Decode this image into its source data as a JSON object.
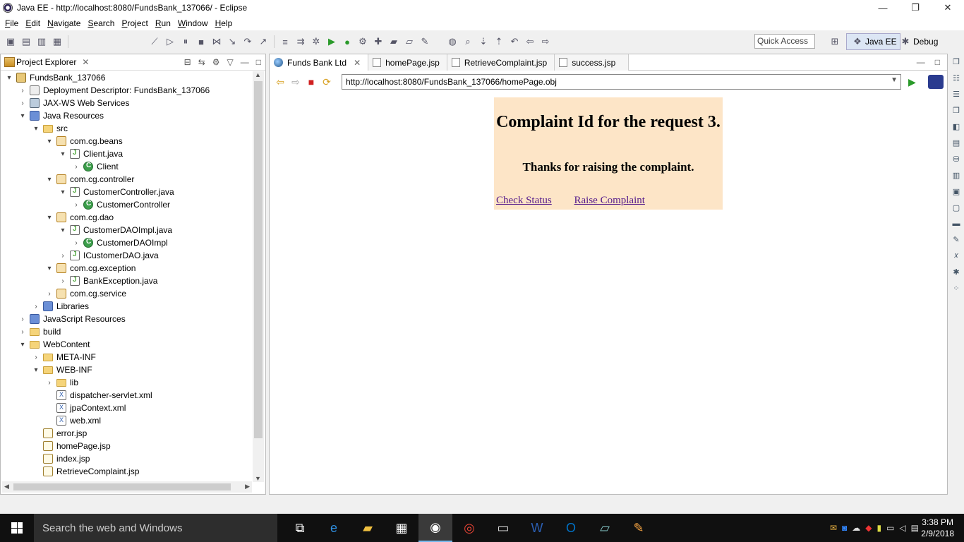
{
  "window": {
    "title": "Java EE - http://localhost:8080/FundsBank_137066/ - Eclipse",
    "minimize_icon": "—",
    "restore_icon": "❐",
    "close_icon": "✕"
  },
  "menu": [
    "File",
    "Edit",
    "Navigate",
    "Search",
    "Project",
    "Run",
    "Window",
    "Help"
  ],
  "toolbar": {
    "quick_access": "Quick Access",
    "perspective_javaee": "Java EE",
    "perspective_debug": "Debug"
  },
  "explorer": {
    "title": "Project Explorer",
    "close_icon": "✕",
    "tree": [
      {
        "label": "FundsBank_137066",
        "depth": 0,
        "expanded": "▾",
        "icon": "project"
      },
      {
        "label": "Deployment Descriptor: FundsBank_137066",
        "depth": 1,
        "expanded": "›",
        "icon": "descriptor"
      },
      {
        "label": "JAX-WS Web Services",
        "depth": 1,
        "expanded": "›",
        "icon": "service"
      },
      {
        "label": "Java Resources",
        "depth": 1,
        "expanded": "▾",
        "icon": "lib"
      },
      {
        "label": "src",
        "depth": 2,
        "expanded": "▾",
        "icon": "folder"
      },
      {
        "label": "com.cg.beans",
        "depth": 3,
        "expanded": "▾",
        "icon": "package"
      },
      {
        "label": "Client.java",
        "depth": 4,
        "expanded": "▾",
        "icon": "java"
      },
      {
        "label": "Client",
        "depth": 5,
        "expanded": "›",
        "icon": "class"
      },
      {
        "label": "com.cg.controller",
        "depth": 3,
        "expanded": "▾",
        "icon": "package"
      },
      {
        "label": "CustomerController.java",
        "depth": 4,
        "expanded": "▾",
        "icon": "java"
      },
      {
        "label": "CustomerController",
        "depth": 5,
        "expanded": "›",
        "icon": "class"
      },
      {
        "label": "com.cg.dao",
        "depth": 3,
        "expanded": "▾",
        "icon": "package"
      },
      {
        "label": "CustomerDAOImpl.java",
        "depth": 4,
        "expanded": "▾",
        "icon": "java"
      },
      {
        "label": "CustomerDAOImpl",
        "depth": 5,
        "expanded": "›",
        "icon": "class"
      },
      {
        "label": "ICustomerDAO.java",
        "depth": 4,
        "expanded": "›",
        "icon": "java"
      },
      {
        "label": "com.cg.exception",
        "depth": 3,
        "expanded": "▾",
        "icon": "package"
      },
      {
        "label": "BankException.java",
        "depth": 4,
        "expanded": "›",
        "icon": "java"
      },
      {
        "label": "com.cg.service",
        "depth": 3,
        "expanded": "›",
        "icon": "package"
      },
      {
        "label": "Libraries",
        "depth": 2,
        "expanded": "›",
        "icon": "lib"
      },
      {
        "label": "JavaScript Resources",
        "depth": 1,
        "expanded": "›",
        "icon": "lib"
      },
      {
        "label": "build",
        "depth": 1,
        "expanded": "›",
        "icon": "folder"
      },
      {
        "label": "WebContent",
        "depth": 1,
        "expanded": "▾",
        "icon": "folder"
      },
      {
        "label": "META-INF",
        "depth": 2,
        "expanded": "›",
        "icon": "folder"
      },
      {
        "label": "WEB-INF",
        "depth": 2,
        "expanded": "▾",
        "icon": "folder"
      },
      {
        "label": "lib",
        "depth": 3,
        "expanded": "›",
        "icon": "folder"
      },
      {
        "label": "dispatcher-servlet.xml",
        "depth": 3,
        "expanded": "",
        "icon": "xml"
      },
      {
        "label": "jpaContext.xml",
        "depth": 3,
        "expanded": "",
        "icon": "xml"
      },
      {
        "label": "web.xml",
        "depth": 3,
        "expanded": "",
        "icon": "xml"
      },
      {
        "label": "error.jsp",
        "depth": 2,
        "expanded": "",
        "icon": "jsp"
      },
      {
        "label": "homePage.jsp",
        "depth": 2,
        "expanded": "",
        "icon": "jsp"
      },
      {
        "label": "index.jsp",
        "depth": 2,
        "expanded": "",
        "icon": "jsp"
      },
      {
        "label": "RetrieveComplaint.jsp",
        "depth": 2,
        "expanded": "",
        "icon": "jsp"
      }
    ]
  },
  "editor": {
    "tabs": [
      {
        "label": "Funds Bank Ltd",
        "active": true
      },
      {
        "label": "homePage.jsp",
        "active": false
      },
      {
        "label": "RetrieveComplaint.jsp",
        "active": false
      },
      {
        "label": "success.jsp",
        "active": false
      }
    ],
    "tab_close_icon": "✕",
    "url": "http://localhost:8080/FundsBank_137066/homePage.obj",
    "page": {
      "heading": "Complaint Id for the request 3.",
      "message": "Thanks for raising the complaint.",
      "link_check_status": "Check Status",
      "link_raise_complaint": "Raise Complaint"
    }
  },
  "taskbar": {
    "search_placeholder": "Search the web and Windows",
    "time": "3:38 PM",
    "date": "2/9/2018"
  }
}
